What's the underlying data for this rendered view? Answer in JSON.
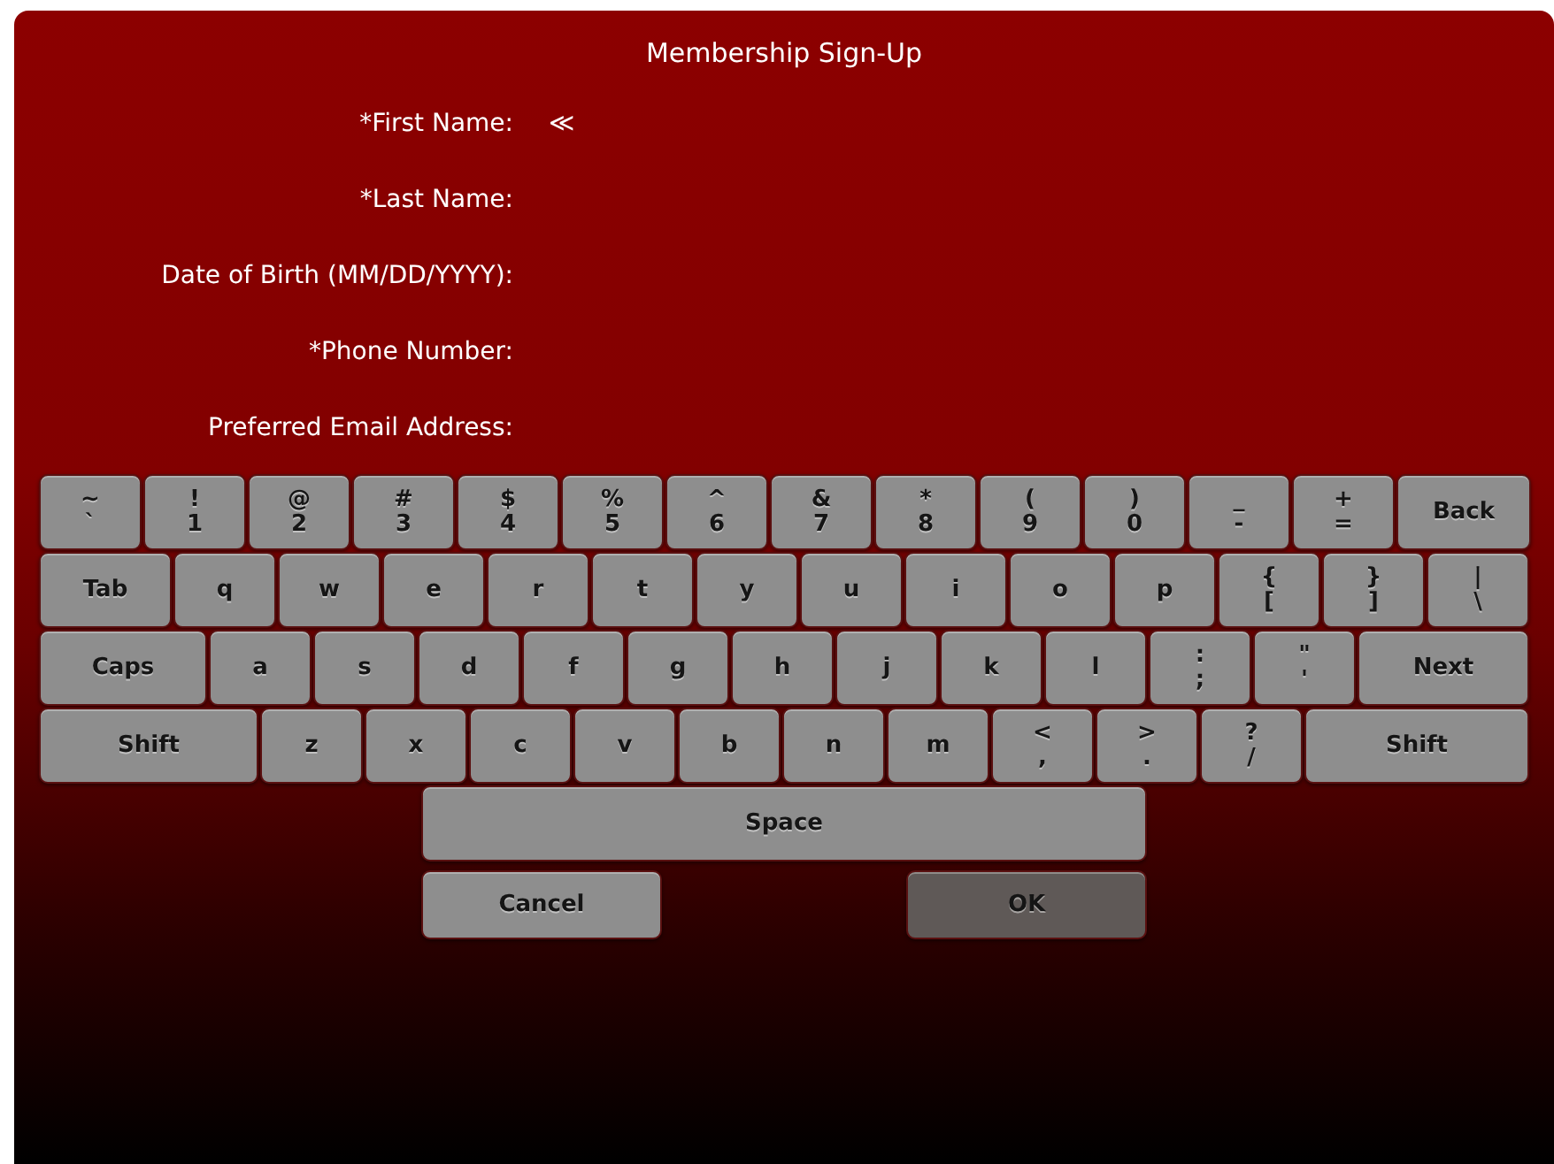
{
  "window": {
    "title": "Membership Sign-Up"
  },
  "fields": [
    {
      "label": "*First Name:",
      "value": "≪"
    },
    {
      "label": "*Last Name:"
    },
    {
      "label": "Date of Birth (MM/DD/YYYY):"
    },
    {
      "label": "*Phone Number:"
    },
    {
      "label": "Preferred Email Address:"
    }
  ],
  "keyboard": {
    "rows": [
      [
        {
          "kind": "dual",
          "upper": "~",
          "lower": "`"
        },
        {
          "kind": "dual",
          "upper": "!",
          "lower": "1"
        },
        {
          "kind": "dual",
          "upper": "@",
          "lower": "2"
        },
        {
          "kind": "dual",
          "upper": "#",
          "lower": "3"
        },
        {
          "kind": "dual",
          "upper": "$",
          "lower": "4"
        },
        {
          "kind": "dual",
          "upper": "%",
          "lower": "5"
        },
        {
          "kind": "dual",
          "upper": "^",
          "lower": "6"
        },
        {
          "kind": "dual",
          "upper": "&",
          "lower": "7"
        },
        {
          "kind": "dual",
          "upper": "*",
          "lower": "8"
        },
        {
          "kind": "dual",
          "upper": "(",
          "lower": "9"
        },
        {
          "kind": "dual",
          "upper": ")",
          "lower": "0"
        },
        {
          "kind": "dual",
          "upper": "_",
          "lower": "-"
        },
        {
          "kind": "dual",
          "upper": "+",
          "lower": "="
        },
        {
          "kind": "wide",
          "label": "Back"
        }
      ],
      [
        {
          "kind": "wide",
          "label": "Tab"
        },
        {
          "kind": "single",
          "label": "q"
        },
        {
          "kind": "single",
          "label": "w"
        },
        {
          "kind": "single",
          "label": "e"
        },
        {
          "kind": "single",
          "label": "r"
        },
        {
          "kind": "single",
          "label": "t"
        },
        {
          "kind": "single",
          "label": "y"
        },
        {
          "kind": "single",
          "label": "u"
        },
        {
          "kind": "single",
          "label": "i"
        },
        {
          "kind": "single",
          "label": "o"
        },
        {
          "kind": "single",
          "label": "p"
        },
        {
          "kind": "dual",
          "upper": "{",
          "lower": "["
        },
        {
          "kind": "dual",
          "upper": "}",
          "lower": "]"
        },
        {
          "kind": "dual",
          "upper": "|",
          "lower": "\\"
        }
      ],
      [
        {
          "kind": "wide",
          "label": "Caps"
        },
        {
          "kind": "single",
          "label": "a"
        },
        {
          "kind": "single",
          "label": "s"
        },
        {
          "kind": "single",
          "label": "d"
        },
        {
          "kind": "single",
          "label": "f"
        },
        {
          "kind": "single",
          "label": "g"
        },
        {
          "kind": "single",
          "label": "h"
        },
        {
          "kind": "single",
          "label": "j"
        },
        {
          "kind": "single",
          "label": "k"
        },
        {
          "kind": "single",
          "label": "l"
        },
        {
          "kind": "dual",
          "upper": ":",
          "lower": ";"
        },
        {
          "kind": "dual",
          "upper": "\"",
          "lower": "'"
        },
        {
          "kind": "wide",
          "label": "Next"
        }
      ],
      [
        {
          "kind": "wide",
          "label": "Shift"
        },
        {
          "kind": "single",
          "label": "z"
        },
        {
          "kind": "single",
          "label": "x"
        },
        {
          "kind": "single",
          "label": "c"
        },
        {
          "kind": "single",
          "label": "v"
        },
        {
          "kind": "single",
          "label": "b"
        },
        {
          "kind": "single",
          "label": "n"
        },
        {
          "kind": "single",
          "label": "m"
        },
        {
          "kind": "dual",
          "upper": "<",
          "lower": ","
        },
        {
          "kind": "dual",
          "upper": ">",
          "lower": "."
        },
        {
          "kind": "dual",
          "upper": "?",
          "lower": "/"
        },
        {
          "kind": "wide",
          "label": "Shift"
        }
      ]
    ],
    "space": "Space"
  },
  "buttons": [
    {
      "label": "Cancel",
      "disabled": false
    },
    {
      "label": "OK",
      "disabled": true
    }
  ]
}
